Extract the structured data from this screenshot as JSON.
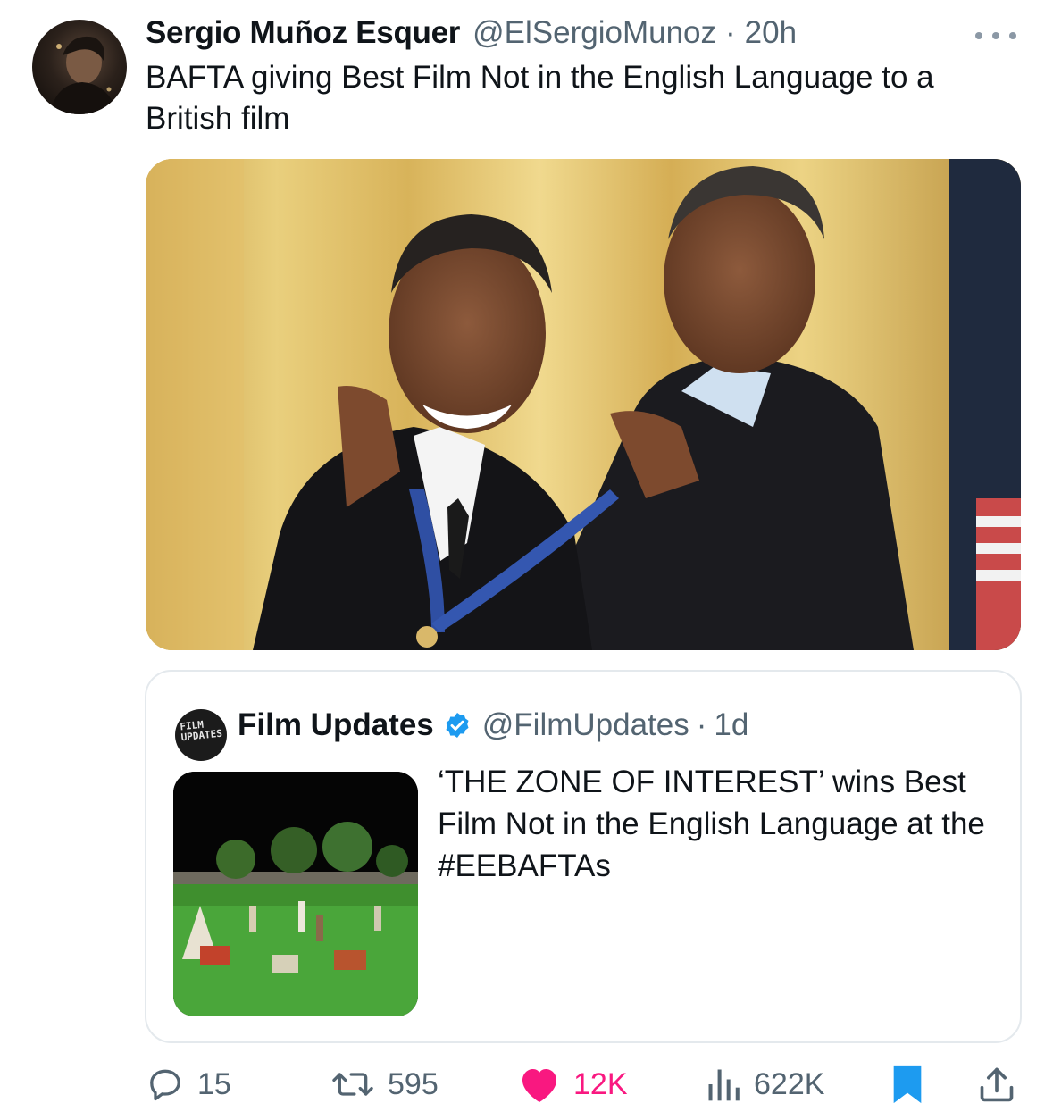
{
  "tweet": {
    "author": {
      "display_name": "Sergio Muñoz Esquer",
      "handle": "@ElSergioMunoz",
      "separator": "·",
      "time": "20h"
    },
    "text": "BAFTA giving Best Film Not in the English Language to a British film",
    "media": {
      "description_icon": "photo"
    }
  },
  "quote": {
    "author": {
      "display_name": "Film Updates",
      "verified": true,
      "handle": "@FilmUpdates",
      "separator": "·",
      "time": "1d",
      "avatar_text": "FILM UPDATES"
    },
    "text": "‘THE ZONE OF INTEREST’ wins Best Film Not in the English Language at the #EEBAFTAs"
  },
  "actions": {
    "replies": "15",
    "reposts": "595",
    "likes": "12K",
    "views": "622K"
  },
  "colors": {
    "secondary_text": "#536471",
    "like": "#f91880",
    "accent": "#1d9bf0",
    "border": "#e4e9ed"
  }
}
